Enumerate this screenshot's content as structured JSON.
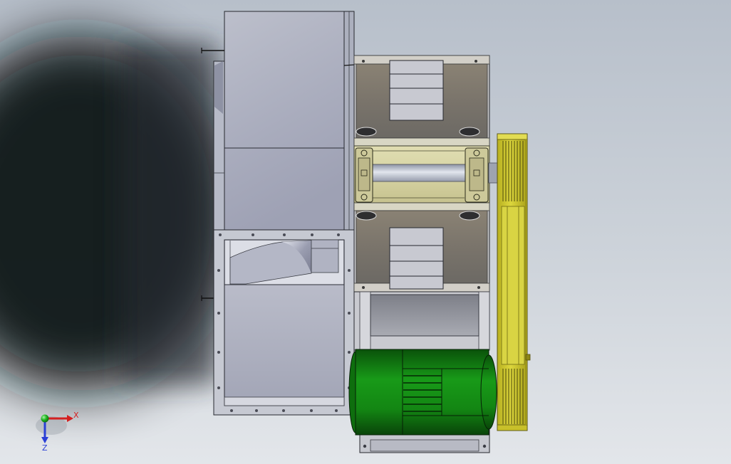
{
  "viewport": {
    "triad": {
      "x_label": "X",
      "z_label": "Z",
      "x_color": "#d42020",
      "y_color": "#22b822",
      "z_color": "#2a3fd6"
    }
  },
  "colors": {
    "background_top": "#b7bfca",
    "background_bottom": "#e3e6ea",
    "housing": "#a9acbd",
    "side_plate": "#7a746b",
    "bearing_pedestal": "#d6d3a3",
    "motor": "#189a18",
    "belt_guard": "#dcd63c"
  }
}
